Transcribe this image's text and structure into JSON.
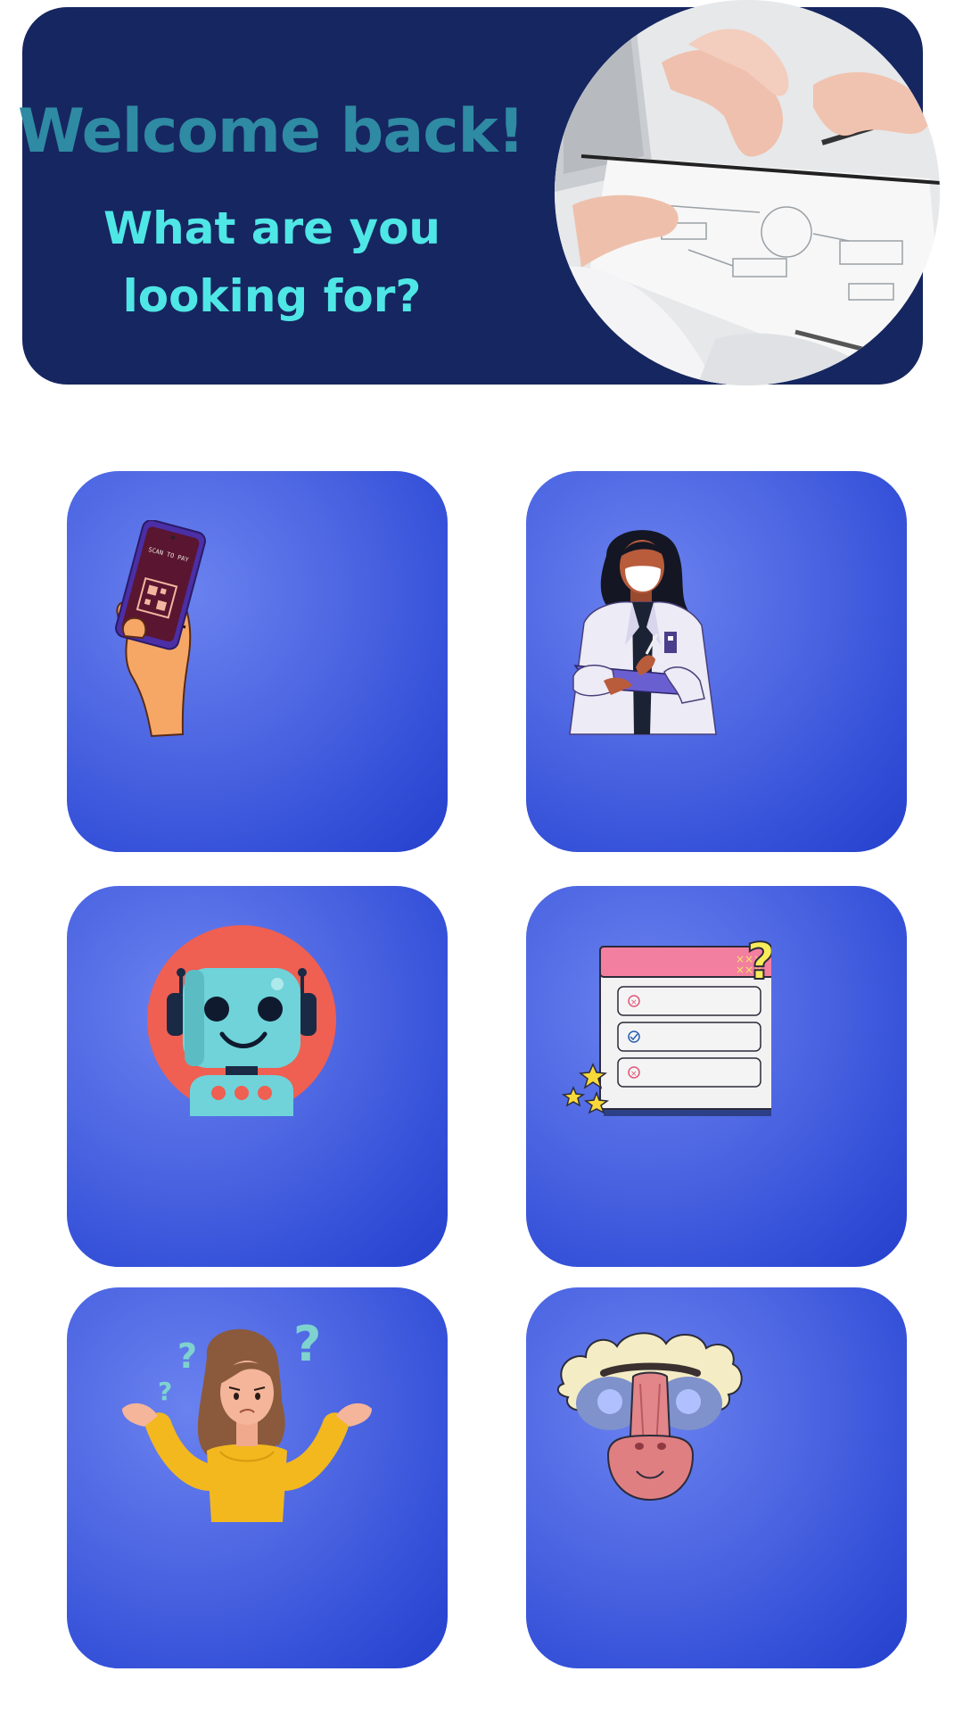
{
  "header": {
    "title": "Welcome back!",
    "subtitle": "What are you looking for?",
    "photo_icon": "hands-reviewing-document-photo"
  },
  "tiles": [
    {
      "icon": "scan-to-pay-phone-icon",
      "phone_text": "SCAN TO PAY"
    },
    {
      "icon": "doctor-icon"
    },
    {
      "icon": "robot-icon"
    },
    {
      "icon": "checklist-icon"
    },
    {
      "icon": "confused-woman-icon"
    },
    {
      "icon": "baboon-mask-icon"
    }
  ],
  "colors": {
    "banner_bg": "#162660",
    "title": "#2f8aa3",
    "subtitle": "#4fe6e6",
    "tile_bg": "#4f68e3"
  }
}
